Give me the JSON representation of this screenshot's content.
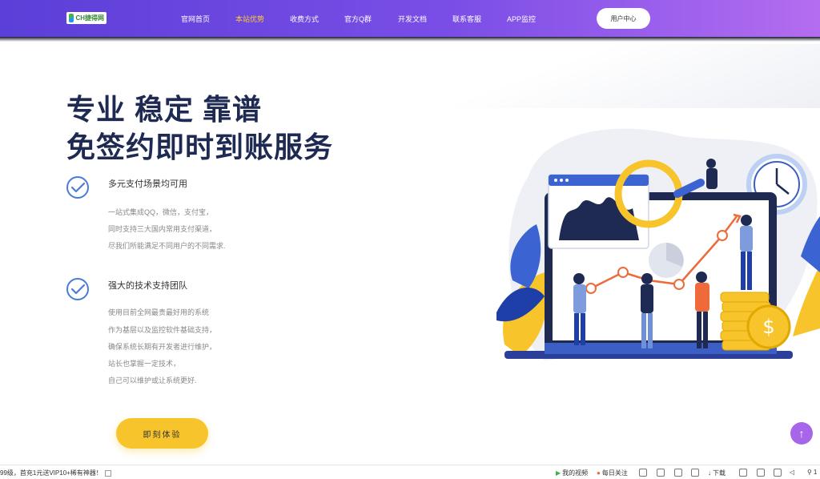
{
  "nav": {
    "logo_text": "CH捷得网",
    "items": [
      {
        "label": "官网首页",
        "active": false
      },
      {
        "label": "本站优势",
        "active": true
      },
      {
        "label": "收费方式",
        "active": false
      },
      {
        "label": "官方Q群",
        "active": false
      },
      {
        "label": "开发文档",
        "active": false
      },
      {
        "label": "联系客服",
        "active": false
      },
      {
        "label": "APP监控",
        "active": false
      }
    ],
    "user_center": "用户中心"
  },
  "hero": {
    "title_line1": "专业 稳定 靠谱",
    "title_line2": "免签约即时到账服务"
  },
  "features": [
    {
      "heading": "多元支付场景均可用",
      "lines": [
        "一站式集成QQ，微信，支付宝，",
        "同时支持三大国内常用支付渠道，",
        "尽我们所能满足不同用户的不同需求."
      ]
    },
    {
      "heading": "强大的技术支持团队",
      "lines": [
        "使用目前全网最贵最好用的系统",
        "作为基层以及监控软件基础支持，",
        "确保系统长期有开发者进行维护，",
        "站长也掌握一定技术，",
        "自己可以维护或让系统更好."
      ]
    }
  ],
  "cta": {
    "label": "即刻体验"
  },
  "to_top": {
    "icon": "arrow-up-icon",
    "glyph": "↑"
  },
  "colors": {
    "accent": "#7a4ee6",
    "active_nav": "#ffcc33",
    "cta": "#f7c52b",
    "title": "#1e2a52",
    "to_top": "#a765ea"
  },
  "statusbar": {
    "promo": "99级，首充1元送VIP10+稀有神器！",
    "my_video": "我的视频",
    "daily_follow": "每日关注",
    "download": "下载",
    "zoom": "1"
  }
}
